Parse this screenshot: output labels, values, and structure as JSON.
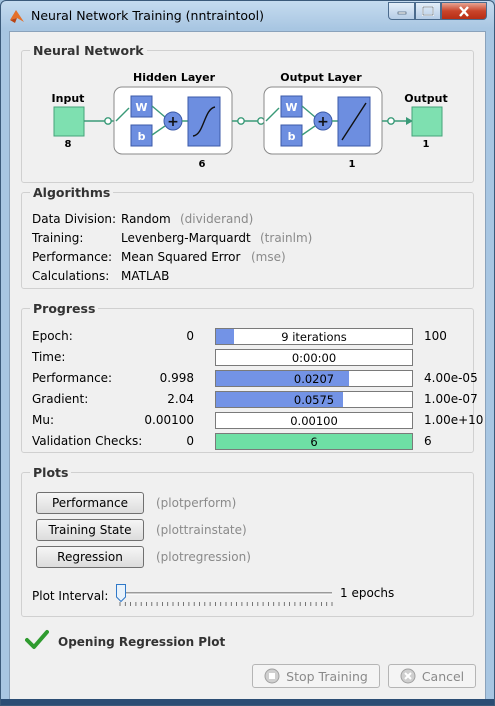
{
  "window": {
    "title": "Neural Network Training (nntraintool)"
  },
  "network": {
    "section_title": "Neural Network",
    "input_label": "Input",
    "input_size": "8",
    "hidden_title": "Hidden Layer",
    "hidden_size": "6",
    "output_layer_title": "Output Layer",
    "output_layer_size": "1",
    "output_label": "Output",
    "output_size": "1",
    "weight": "W",
    "bias": "b"
  },
  "algorithms": {
    "section_title": "Algorithms",
    "rows": [
      {
        "label": "Data Division:",
        "value": "Random",
        "fn": "(dividerand)"
      },
      {
        "label": "Training:",
        "value": "Levenberg-Marquardt",
        "fn": "(trainlm)"
      },
      {
        "label": "Performance:",
        "value": "Mean Squared Error",
        "fn": "(mse)"
      },
      {
        "label": "Calculations:",
        "value": "MATLAB",
        "fn": ""
      }
    ]
  },
  "progress": {
    "section_title": "Progress",
    "rows": [
      {
        "label": "Epoch:",
        "start": "0",
        "bar_text": "9 iterations",
        "end": "100",
        "fill": 0.09
      },
      {
        "label": "Time:",
        "start": "",
        "bar_text": "0:00:00",
        "end": "",
        "fill": 0
      },
      {
        "label": "Performance:",
        "start": "0.998",
        "bar_text": "0.0207",
        "end": "4.00e-05",
        "fill": 0.68
      },
      {
        "label": "Gradient:",
        "start": "2.04",
        "bar_text": "0.0575",
        "end": "1.00e-07",
        "fill": 0.65
      },
      {
        "label": "Mu:",
        "start": "0.00100",
        "bar_text": "0.00100",
        "end": "1.00e+10",
        "fill": 0
      },
      {
        "label": "Validation Checks:",
        "start": "0",
        "bar_text": "6",
        "end": "6",
        "fill": 1.0
      }
    ]
  },
  "plots": {
    "section_title": "Plots",
    "buttons": [
      {
        "label": "Performance",
        "fn": "(plotperform)"
      },
      {
        "label": "Training State",
        "fn": "(plottrainstate)"
      },
      {
        "label": "Regression",
        "fn": "(plotregression)"
      }
    ],
    "interval_label": "Plot Interval:",
    "interval_value": "1 epochs",
    "interval_level": 0
  },
  "status": {
    "message": "Opening Regression Plot"
  },
  "buttons": {
    "stop": "Stop Training",
    "cancel": "Cancel"
  },
  "colors": {
    "bar_fill": "#7393e6",
    "validation_fill": "#6ee0a5",
    "node_green": "#7ee0b0",
    "layer_blue": "#6d8ee0"
  }
}
